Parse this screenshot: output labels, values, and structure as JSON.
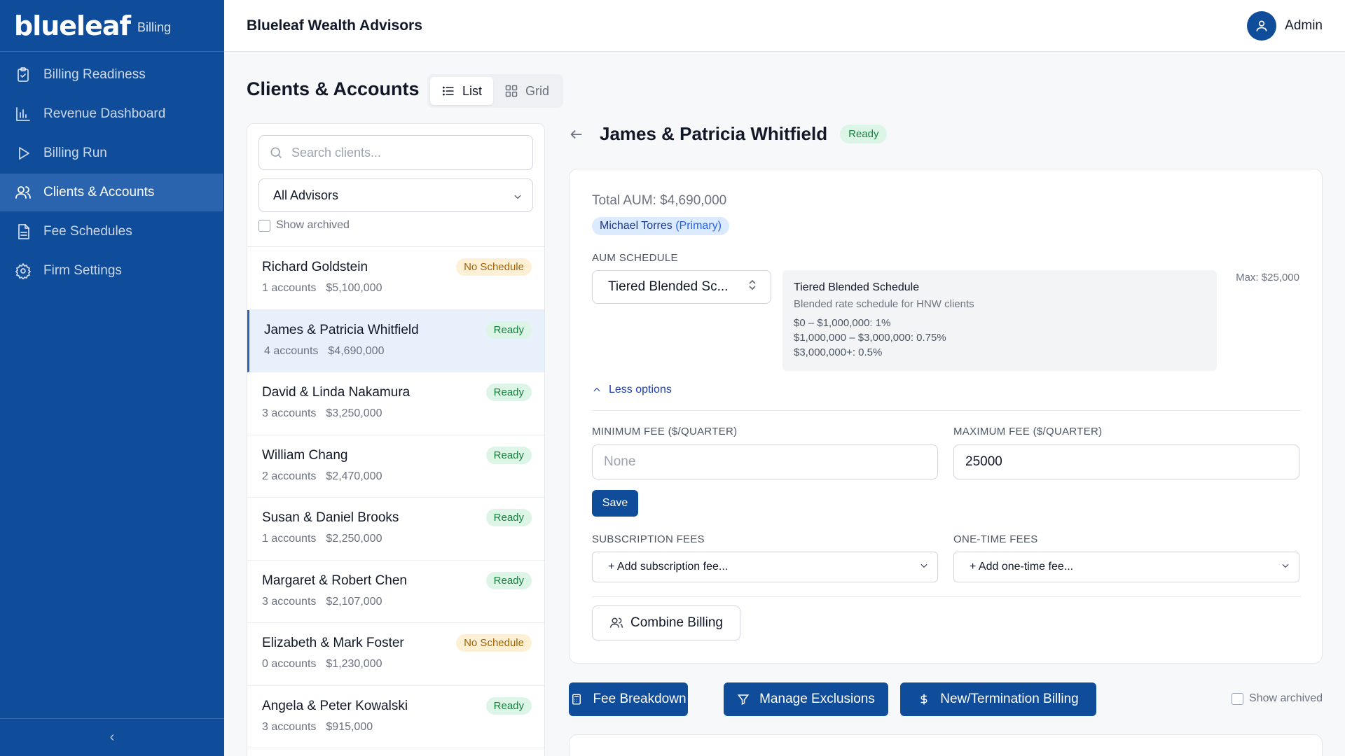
{
  "sidebar": {
    "logo": "blueleaf",
    "logo_sub": "Billing",
    "items": [
      {
        "label": "Billing Readiness",
        "icon": "clipboard-check-icon"
      },
      {
        "label": "Revenue Dashboard",
        "icon": "bar-chart-icon"
      },
      {
        "label": "Billing Run",
        "icon": "play-icon"
      },
      {
        "label": "Clients & Accounts",
        "icon": "users-icon",
        "active": true
      },
      {
        "label": "Fee Schedules",
        "icon": "document-icon"
      },
      {
        "label": "Firm Settings",
        "icon": "gear-icon"
      }
    ],
    "collapse_glyph": "‹"
  },
  "header": {
    "firm_name": "Blueleaf Wealth Advisors",
    "user_name": "Admin"
  },
  "page": {
    "title": "Clients & Accounts",
    "view_list": "List",
    "view_grid": "Grid"
  },
  "client_panel": {
    "search_placeholder": "Search clients...",
    "advisor_filter": "All Advisors",
    "show_archived": "Show archived",
    "clients": [
      {
        "name": "Richard Goldstein",
        "accounts": "1 accounts",
        "aum": "$5,100,000",
        "status": "No Schedule"
      },
      {
        "name": "James & Patricia Whitfield",
        "accounts": "4 accounts",
        "aum": "$4,690,000",
        "status": "Ready"
      },
      {
        "name": "David & Linda Nakamura",
        "accounts": "3 accounts",
        "aum": "$3,250,000",
        "status": "Ready"
      },
      {
        "name": "William Chang",
        "accounts": "2 accounts",
        "aum": "$2,470,000",
        "status": "Ready"
      },
      {
        "name": "Susan & Daniel Brooks",
        "accounts": "1 accounts",
        "aum": "$2,250,000",
        "status": "Ready"
      },
      {
        "name": "Margaret & Robert Chen",
        "accounts": "3 accounts",
        "aum": "$2,107,000",
        "status": "Ready"
      },
      {
        "name": "Elizabeth & Mark Foster",
        "accounts": "0 accounts",
        "aum": "$1,230,000",
        "status": "No Schedule"
      },
      {
        "name": "Angela & Peter Kowalski",
        "accounts": "3 accounts",
        "aum": "$915,000",
        "status": "Ready"
      }
    ]
  },
  "detail": {
    "client_name": "James & Patricia Whitfield",
    "status": "Ready",
    "total_aum": "Total AUM: $4,690,000",
    "advisor": "Michael Torres",
    "advisor_role": "(Primary)",
    "aum_schedule_label": "AUM SCHEDULE",
    "aum_schedule_value": "Tiered Blended Sc...",
    "schedule_info": {
      "title": "Tiered Blended Schedule",
      "description": "Blended rate schedule for HNW clients",
      "tiers": [
        "$0 – $1,000,000: 1%",
        "$1,000,000 – $3,000,000: 0.75%",
        "$3,000,000+: 0.5%"
      ]
    },
    "max_note": "Max: $25,000",
    "less_options": "Less options",
    "min_fee_label": "MINIMUM FEE ($/QUARTER)",
    "min_fee_placeholder": "None",
    "max_fee_label": "MAXIMUM FEE ($/QUARTER)",
    "max_fee_value": "25000",
    "save_label": "Save",
    "subscription_label": "SUBSCRIPTION FEES",
    "subscription_placeholder": "+ Add subscription fee...",
    "onetime_label": "ONE-TIME FEES",
    "onetime_placeholder": "+ Add one-time fee...",
    "combine_label": "Combine Billing"
  },
  "actions": {
    "fee_breakdown": "Fee Breakdown",
    "manage_exclusions": "Manage Exclusions",
    "new_termination": "New/Termination Billing",
    "show_archived": "Show archived"
  },
  "colors": {
    "sidebar_bg": "#0f4c9a",
    "sidebar_active": "#2a64ae",
    "primary_button": "#0f4c9a",
    "ready_badge": "#dcf5e6",
    "noschedule_badge": "#fdf0d5"
  }
}
